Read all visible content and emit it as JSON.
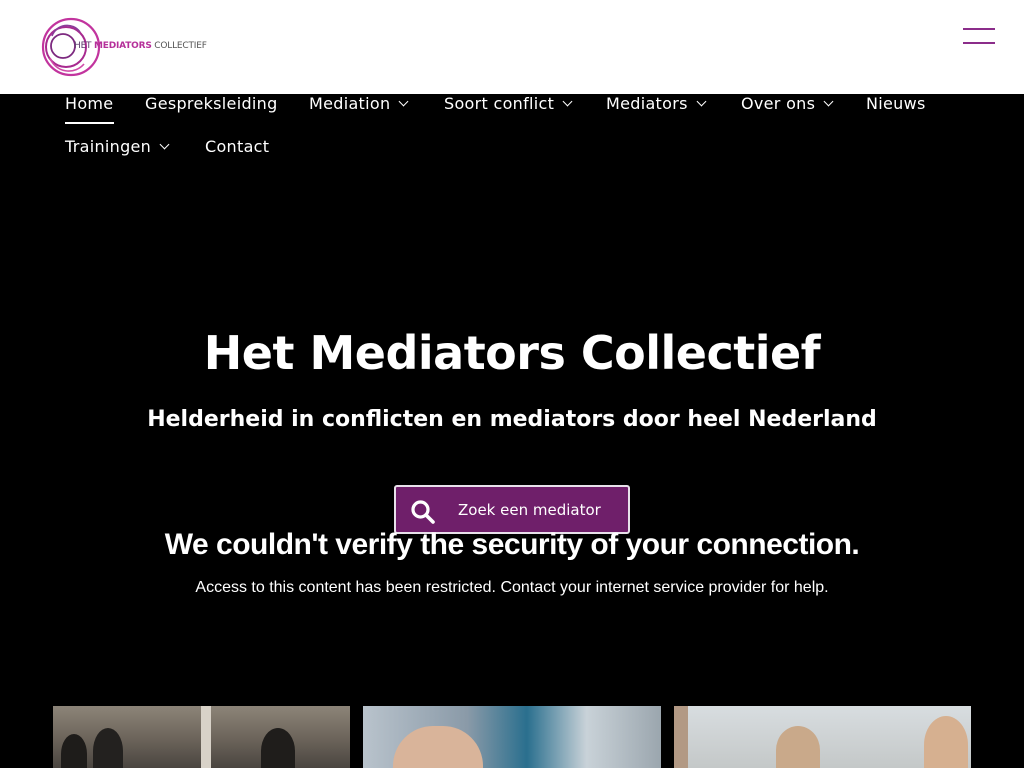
{
  "header": {
    "logo": {
      "text_het": "HET",
      "text_mediators": "MEDIATORS",
      "text_collectief": "COLLECTIEF"
    },
    "menu_icon": "hamburger-menu-icon"
  },
  "nav": {
    "items": [
      {
        "label": "Home",
        "active": true,
        "dropdown": false
      },
      {
        "label": "Gespreksleiding",
        "dropdown": false
      },
      {
        "label": "Mediation",
        "dropdown": true
      },
      {
        "label": "Soort conflict",
        "dropdown": true
      },
      {
        "label": "Mediators",
        "dropdown": true
      },
      {
        "label": "Over ons",
        "dropdown": true
      },
      {
        "label": "Nieuws",
        "dropdown": false
      },
      {
        "label": "Trainingen",
        "dropdown": true
      },
      {
        "label": "Contact",
        "dropdown": false
      }
    ]
  },
  "hero": {
    "title": "Het Mediators Collectief",
    "subtitle": "Helderheid in conflicten en mediators door heel Nederland",
    "search_button": {
      "label": "Zoek een mediator",
      "icon": "search-icon"
    }
  },
  "error": {
    "title": "We couldn't verify the security of your connection.",
    "message": "Access to this content has been restricted. Contact your internet service provider for help."
  },
  "colors": {
    "brand_purple": "#6f1f6a",
    "logo_magenta": "#b5309a",
    "background": "#000000"
  }
}
